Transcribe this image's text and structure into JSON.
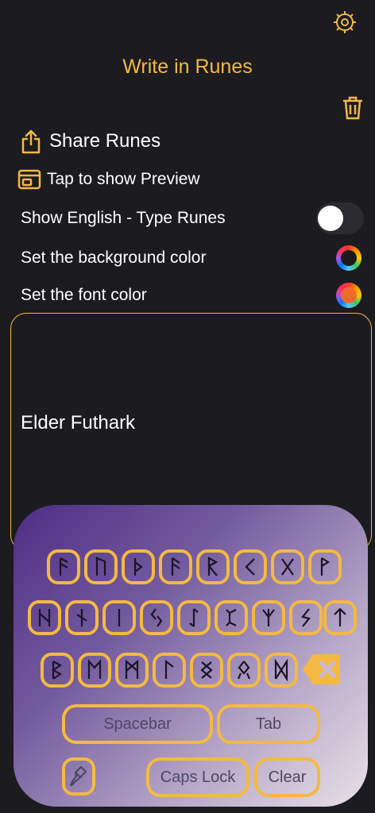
{
  "header": {
    "title": "Write in Runes"
  },
  "actions": {
    "share_label": "Share Runes",
    "preview_label": "Tap to show Preview",
    "show_english_label": "Show English - Type Runes",
    "background_color_label": "Set the background color",
    "font_color_label": "Set the font color"
  },
  "colors": {
    "accent": "#f4b942",
    "background": "#1c1b1f",
    "bg_color_swatch": "#1c1b1f",
    "font_color_swatch": "#f26a2e"
  },
  "toggle": {
    "show_english": false
  },
  "editor": {
    "text": "Elder Futhark"
  },
  "keyboard": {
    "rows": [
      [
        "fehu",
        "uruz",
        "thurisaz",
        "ansuz",
        "raido",
        "kaunan",
        "gebo",
        "wunjo"
      ],
      [
        "hagalaz",
        "naudiz",
        "isaz",
        "jera",
        "eihwaz",
        "perth",
        "algiz",
        "sowilo",
        "tiwaz"
      ],
      [
        "berkanan",
        "ehwaz",
        "mannaz",
        "laguz",
        "ingwaz",
        "othala",
        "dagaz"
      ]
    ],
    "spacebar_label": "Spacebar",
    "tab_label": "Tab",
    "capslock_label": "Caps Lock",
    "clear_label": "Clear",
    "icons": [
      "backspace-icon",
      "paintbrush-icon"
    ]
  }
}
